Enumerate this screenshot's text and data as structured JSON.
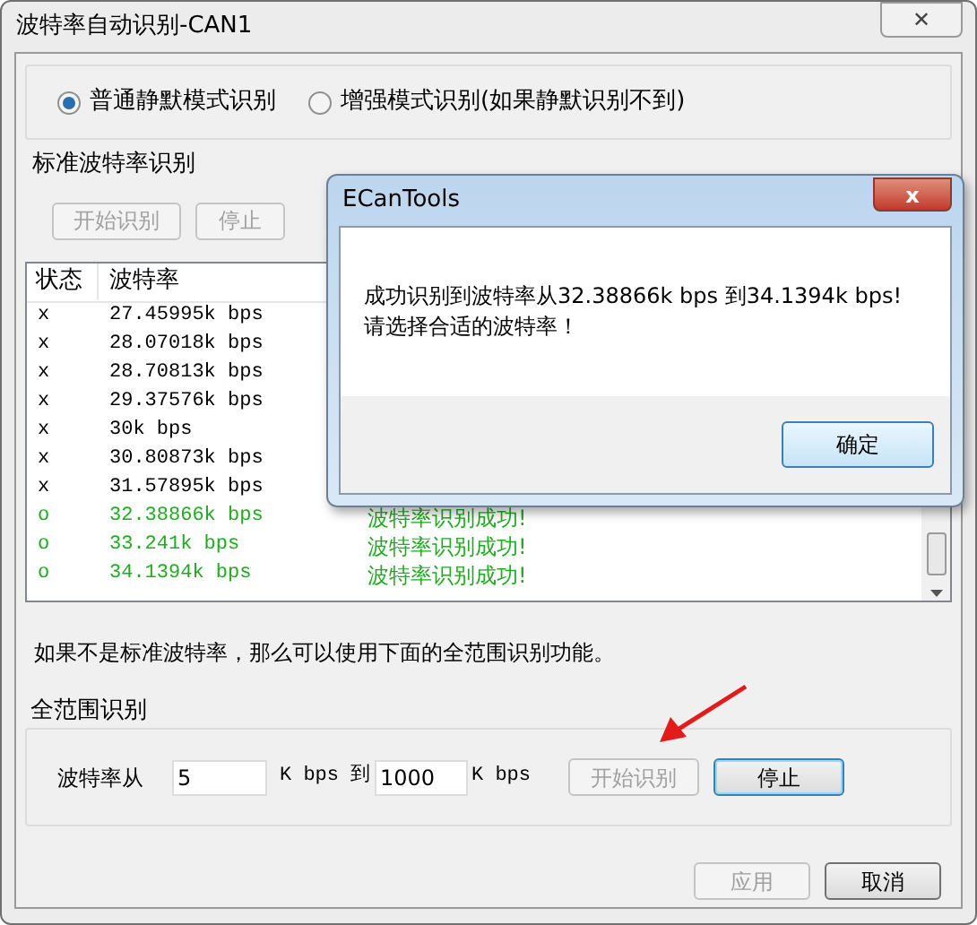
{
  "window": {
    "title": "波特率自动识别-CAN1",
    "close": "✕"
  },
  "modes": [
    {
      "label": "普通静默模式识别",
      "selected": true
    },
    {
      "label": "增强模式识别(如果静默识别不到)",
      "selected": false
    }
  ],
  "standard": {
    "title": "标准波特率识别",
    "buttons": [
      {
        "label": "开始识别",
        "disabled": true
      },
      {
        "label": "停止",
        "disabled": true
      }
    ],
    "columns": [
      "状态",
      "波特率"
    ],
    "rows": [
      {
        "status": "x",
        "rate": "27.45995k bps",
        "color": "#000000"
      },
      {
        "status": "x",
        "rate": "28.07018k bps",
        "color": "#000000"
      },
      {
        "status": "x",
        "rate": "28.70813k bps",
        "color": "#000000"
      },
      {
        "status": "x",
        "rate": "29.37576k bps",
        "color": "#000000"
      },
      {
        "status": "x",
        "rate": "30k bps",
        "color": "#000000"
      },
      {
        "status": "x",
        "rate": "30.80873k bps",
        "color": "#000000"
      },
      {
        "status": "x",
        "rate": "31.57895k bps",
        "color": "#000000"
      },
      {
        "status": "o",
        "rate": "32.38866k bps",
        "result": "波特率识别成功!",
        "color": "#22aa22"
      },
      {
        "status": "o",
        "rate": "33.241k bps",
        "result": "波特率识别成功!",
        "color": "#22aa22"
      },
      {
        "status": "o",
        "rate": "34.1394k bps",
        "result": "波特率识别成功!",
        "color": "#22aa22"
      }
    ]
  },
  "hint": "如果不是标准波特率，那么可以使用下面的全范围识别功能。",
  "full_range": {
    "title": "全范围识别",
    "from_label": "波特率从",
    "from_value": "5",
    "unit_to": "K bps 到",
    "to_value": "1000",
    "unit": "K bps",
    "buttons": [
      {
        "label": "开始识别",
        "disabled": true,
        "default": false
      },
      {
        "label": "停止",
        "disabled": false,
        "default": true
      }
    ]
  },
  "footer_buttons": [
    {
      "label": "应用",
      "disabled": true
    },
    {
      "label": "取消",
      "disabled": false
    }
  ],
  "message_box": {
    "title": "ECanTools",
    "close": "x",
    "lines": [
      "成功识别到波特率从32.38866k bps 到34.1394k bps!",
      "请选择合适的波特率！"
    ],
    "ok": "确定"
  }
}
